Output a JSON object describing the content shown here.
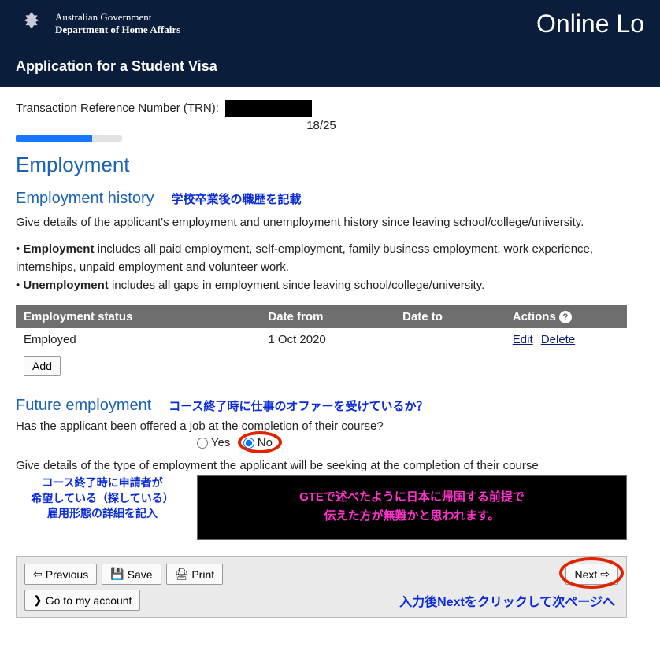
{
  "gov": {
    "line1": "Australian Government",
    "line2": "Department of Home Affairs"
  },
  "brand": "Online Lo",
  "app_title": "Application for a Student Visa",
  "trn_label": "Transaction Reference Number (TRN):",
  "page_progress": "18/25",
  "section_title": "Employment",
  "history": {
    "heading": "Employment history",
    "jp_note": "学校卒業後の職歴を記載",
    "intro": "Give details of the applicant's employment and unemployment history since leaving school/college/university.",
    "bullet1_label": "Employment",
    "bullet1_text": " includes all paid employment, self-employment, family business employment, work experience, internships, unpaid employment and volunteer work.",
    "bullet2_label": "Unemployment",
    "bullet2_text": " includes all gaps in employment since leaving school/college/university."
  },
  "table": {
    "h_status": "Employment status",
    "h_from": "Date from",
    "h_to": "Date to",
    "h_actions": "Actions",
    "rows": [
      {
        "status": "Employed",
        "from": "1 Oct 2020",
        "to": "",
        "edit": "Edit",
        "del": "Delete"
      }
    ],
    "add": "Add"
  },
  "future": {
    "heading": "Future employment",
    "jp_note": "コース終了時に仕事のオファーを受けているか？",
    "q1": "Has the applicant been offered a job at the completion of their course?",
    "opt_yes": "Yes",
    "opt_no": "No",
    "q2": "Give details of the type of employment the applicant will be seeking at the completion of their course",
    "jp_left": "コース終了時に申請者が\n希望している（探している）\n雇用形態の詳細を記入",
    "magenta1": "GTEで述べたように日本に帰国する前提で",
    "magenta2": "伝えた方が無難かと思われます。"
  },
  "nav": {
    "previous": "Previous",
    "save": "Save",
    "print": "Print",
    "next": "Next",
    "account": "Go to my account",
    "jp_next": "入力後Nextをクリックして次ページへ"
  }
}
